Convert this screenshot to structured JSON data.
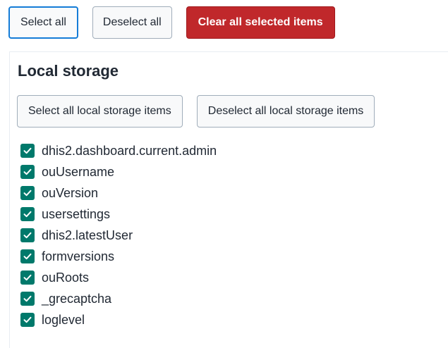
{
  "toolbar": {
    "select_all_label": "Select all",
    "deselect_all_label": "Deselect all",
    "clear_selected_label": "Clear all selected items"
  },
  "local_storage": {
    "title": "Local storage",
    "select_all_label": "Select all local storage items",
    "deselect_all_label": "Deselect all local storage items",
    "items": [
      {
        "label": "dhis2.dashboard.current.admin",
        "checked": true
      },
      {
        "label": "ouUsername",
        "checked": true
      },
      {
        "label": "ouVersion",
        "checked": true
      },
      {
        "label": "usersettings",
        "checked": true
      },
      {
        "label": "dhis2.latestUser",
        "checked": true
      },
      {
        "label": "formversions",
        "checked": true
      },
      {
        "label": "ouRoots",
        "checked": true
      },
      {
        "label": "_grecaptcha",
        "checked": true
      },
      {
        "label": "loglevel",
        "checked": true
      }
    ]
  },
  "colors": {
    "accent_blue": "#147cd7",
    "destructive_red": "#c0282b",
    "checkbox_green": "#00796b"
  },
  "icons": {
    "checkbox": "checkmark-icon"
  }
}
